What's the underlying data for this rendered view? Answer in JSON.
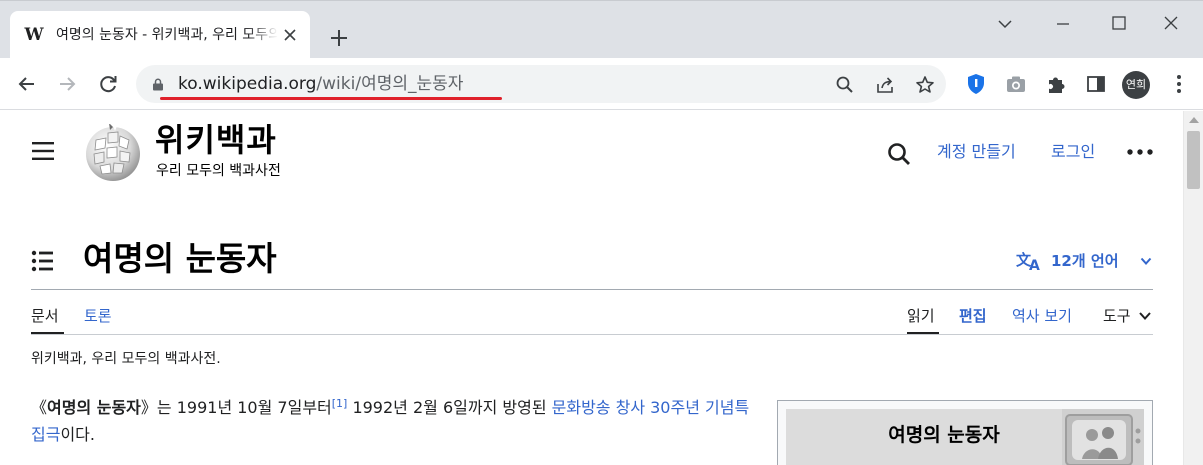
{
  "browser": {
    "tab": {
      "favicon": "W",
      "title": "여명의 눈동자 - 위키백과, 우리 모두의 백과사전"
    },
    "url": {
      "host": "ko.wikipedia.org",
      "path": "/wiki/여명의_눈동자"
    },
    "profile_initials": "연희",
    "icons": [
      "back-icon",
      "forward-icon",
      "reload-icon",
      "lock-icon",
      "zoom-icon",
      "share-icon",
      "star-icon",
      "shield-extension-icon",
      "camera-extension-icon",
      "puzzle-icon",
      "side-panel-icon",
      "more-vertical-icon"
    ],
    "annotation_color": "#e0212b"
  },
  "site": {
    "wordmark": "위키백과",
    "tagline": "우리 모두의 백과사전",
    "create_account": "계정 만들기",
    "login": "로그인"
  },
  "article": {
    "title": "여명의 눈동자",
    "languages": "12개 언어",
    "tabs_left": [
      "문서",
      "토론"
    ],
    "tabs_right": {
      "read": "읽기",
      "edit": "편집",
      "history": "역사 보기",
      "tools": "도구"
    },
    "from": "위키백과, 우리 모두의 백과사전.",
    "lead": {
      "open_bracket": "《",
      "bold": "여명의 눈동자",
      "close_bracket": "》",
      "t1": "는 1991년 10월 7일부터",
      "ref": "[1]",
      "t2": " 1992년 2월 6일까지 방영된 ",
      "link": "문화방송 창사 30주년 기념특집극",
      "t3": "이다."
    },
    "infobox_title": "여명의 눈동자"
  },
  "colors": {
    "link": "#3366cc",
    "text": "#202122",
    "chrome": "#dee1e6"
  }
}
